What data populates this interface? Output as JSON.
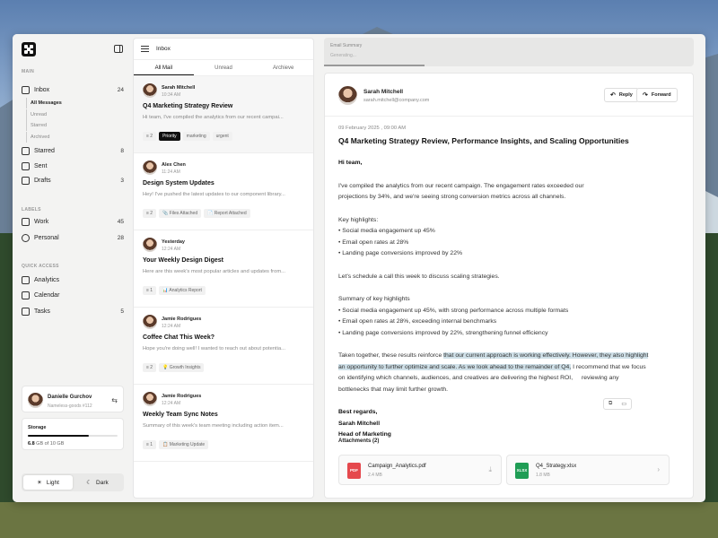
{
  "sidebar": {
    "main_label": "MAIN",
    "inbox": {
      "label": "Inbox",
      "count": "24"
    },
    "inbox_sub": [
      "All Messages",
      "Unread",
      "Starred",
      "Archived"
    ],
    "starred": {
      "label": "Starred",
      "count": "8"
    },
    "sent": {
      "label": "Sent"
    },
    "drafts": {
      "label": "Drafts",
      "count": "3"
    },
    "labels_label": "LABELS",
    "work": {
      "label": "Work",
      "count": "45"
    },
    "personal": {
      "label": "Personal",
      "count": "28"
    },
    "quick_label": "QUICK ACCESS",
    "analytics": {
      "label": "Analytics"
    },
    "calendar": {
      "label": "Calendar"
    },
    "tasks": {
      "label": "Tasks",
      "count": "5"
    },
    "user": {
      "name": "Danielle Gurchov",
      "sub": "Nameless-goods #112"
    },
    "storage": {
      "title": "Storage",
      "used": "6.8",
      "total": " GB of 10 GB",
      "fraction": 0.68
    },
    "theme": {
      "light": "Light",
      "dark": "Dark"
    }
  },
  "list": {
    "title": "Inbox",
    "tabs": [
      "All Mail",
      "Unread",
      "Archieve"
    ],
    "mails": [
      {
        "from": "Sarah Mitchell",
        "time": "10:34 AM",
        "subject": "Q4 Marketing Strategy Review",
        "preview": "Hi team, I've compiled the analytics from our recent campai...",
        "tags": [
          "≡ 2",
          "Priority",
          "marketing",
          "urgent"
        ]
      },
      {
        "from": "Alex Chen",
        "time": "11:24 AM",
        "subject": "Design System Updates",
        "preview": "Hey! I've pushed the latest updates to our component library...",
        "tags": [
          "≡ 2",
          "📎 Files Attached",
          "📄 Report Attached"
        ]
      },
      {
        "from": "Yesterday",
        "time": "12:24 AM",
        "subject": "Your Weekly Design Digest",
        "preview": "Here are this week's most popular articles and updates from...",
        "tags": [
          "≡ 1",
          "📊 Analytics Report"
        ]
      },
      {
        "from": "Jamie Rodrigues",
        "time": "12:24 AM",
        "subject": "Coffee Chat This Week?",
        "preview": "Hope you're doing well! I wanted to reach out about potentia...",
        "tags": [
          "≡ 2",
          "💡 Growth Insights"
        ]
      },
      {
        "from": "Jamie Rodrigues",
        "time": "12:24 AM",
        "subject": "Weekly Team Sync Notes",
        "preview": "Summary of this week's team meeting including action item...",
        "tags": [
          "≡ 1",
          "📋 Marketing Update"
        ]
      }
    ]
  },
  "summary": {
    "title": "Email Summary",
    "sub": "Generating..."
  },
  "email": {
    "from": "Sarah Mitchell",
    "email": "sarah.mitchell@company.com",
    "reply": "Reply",
    "forward": "Forward",
    "date": "09 February 2025 , 09:00 AM",
    "subject": "Q4 Marketing Strategy Review, Performance Insights, and Scaling Opportunities",
    "greeting": "Hi team,",
    "p1a": "I've compiled the analytics from our recent campaign. The engagement rates exceeded our",
    "p1b": "projections by 34%, and we're seeing strong conversion metrics across all channels.",
    "kh": "Key highlights:",
    "kh1": "• Social media engagement up 45%",
    "kh2": "• Email open rates at 28%",
    "kh3": "• Landing page conversions improved by 22%",
    "p2": "Let's schedule a call this week to discuss scaling strategies.",
    "sk": "Summary of key highlights",
    "sk1": "•  Social media engagement up 45%, with strong performance across multiple formats",
    "sk2": "•  Email open rates at 28%, exceeding internal benchmarks",
    "sk3": "•  Landing page conversions improved by 22%, strengthening funnel efficiency",
    "p3a": "Taken together, these results reinforce ",
    "p3h1": "that our current approach is working effectively. However, they also highlight",
    "p3h2": "an opportunity to further optimize and scale. As we look ahead to the remainder of Q4,",
    "p3b": " I recommend that we focus",
    "p3c": "on identifying which channels, audiences, and creatives are delivering the highest ROI, ",
    "p3d": "reviewing any",
    "p3e": "bottlenecks that may limit further growth.",
    "sign1": "Best regards,",
    "sign2": "Sarah Mitchell",
    "sign3": "Head of Marketing",
    "attach_title": "Attachments (2)",
    "files": [
      {
        "type": "PDF",
        "name": "Campaign_Analytics.pdf",
        "size": "2.4 MB",
        "color": "#e5484d"
      },
      {
        "type": "XLSX",
        "name": "Q4_Strategy.xlsx",
        "size": "1.8 MB",
        "color": "#1f9d55"
      }
    ]
  }
}
